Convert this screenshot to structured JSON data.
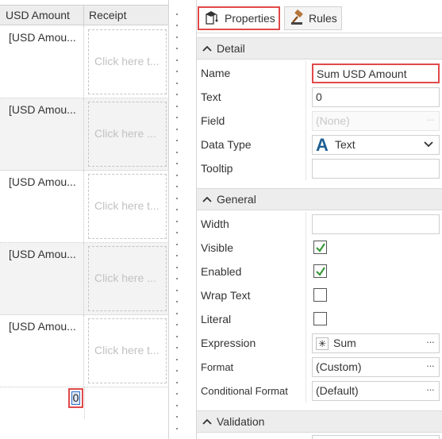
{
  "grid": {
    "columns": {
      "usd_amount": "USD Amount",
      "receipt": "Receipt"
    },
    "rows": [
      {
        "usd": "[USD Amou...",
        "receipt": "Click here t..."
      },
      {
        "usd": "[USD Amou...",
        "receipt": "Click here ..."
      },
      {
        "usd": "[USD Amou...",
        "receipt": "Click here t..."
      },
      {
        "usd": "[USD Amou...",
        "receipt": "Click here ..."
      },
      {
        "usd": "[USD Amou...",
        "receipt": "Click here t..."
      }
    ],
    "footer_value": "0"
  },
  "tabs": {
    "properties": "Properties",
    "rules": "Rules"
  },
  "sections": {
    "detail": "Detail",
    "general": "General",
    "validation": "Validation"
  },
  "detail": {
    "name_label": "Name",
    "name_value": "Sum USD Amount",
    "text_label": "Text",
    "text_value": "0",
    "field_label": "Field",
    "field_value": "(None)",
    "datatype_label": "Data Type",
    "datatype_value": "Text",
    "tooltip_label": "Tooltip",
    "tooltip_value": ""
  },
  "general": {
    "width_label": "Width",
    "width_value": "",
    "visible_label": "Visible",
    "visible_checked": true,
    "enabled_label": "Enabled",
    "enabled_checked": true,
    "wrap_label": "Wrap Text",
    "wrap_checked": false,
    "literal_label": "Literal",
    "literal_checked": false,
    "expression_label": "Expression",
    "expression_value": "Sum",
    "format_label": "Format",
    "format_value": "(Custom)",
    "condformat_label": "Conditional Format",
    "condformat_value": "(Default)"
  },
  "colors": {
    "highlight_border": "#e04a4a",
    "check_green": "#3a9a3a",
    "datatype_icon": "#1d5e93"
  }
}
